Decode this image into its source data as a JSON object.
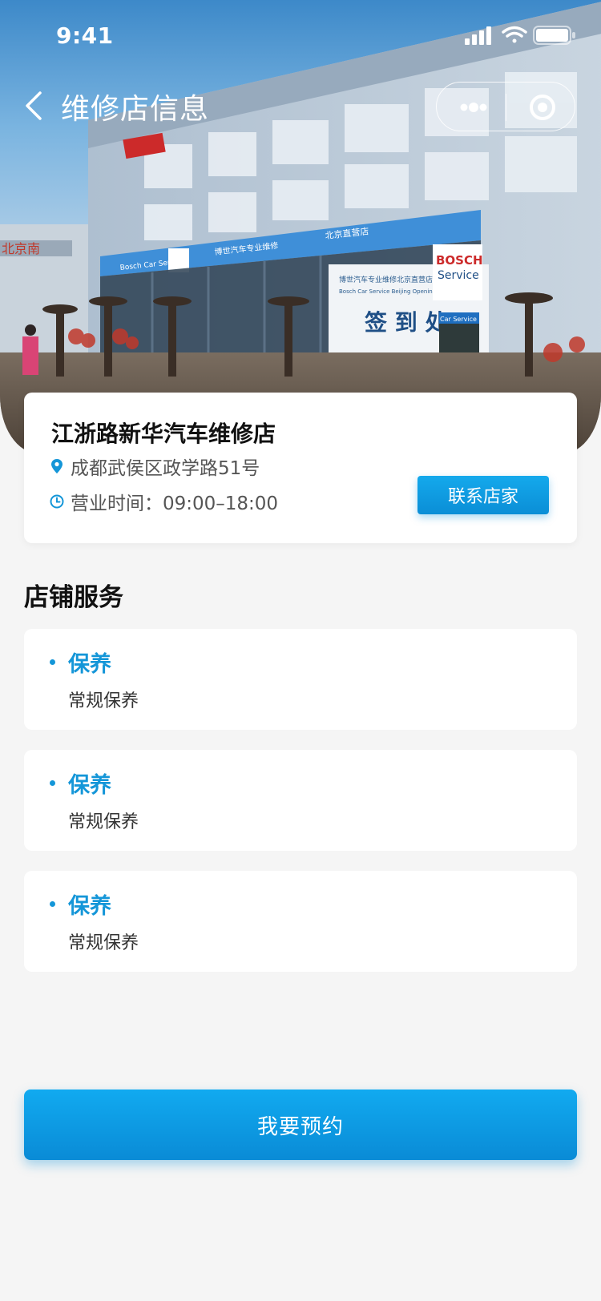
{
  "status_bar": {
    "time": "9:41"
  },
  "nav": {
    "title": "维修店信息"
  },
  "hero": {
    "signage": {
      "bosch": "BOSCH",
      "service": "Service",
      "car_service": "Car Service",
      "board_title": "签 到 处",
      "board_line1": "博世汽车专业维修北京直营店",
      "board_line2": "Bosch Car Service Beijing Opening",
      "fascia_left": "博世汽车专业维修",
      "fascia_right": "北京直营店",
      "fascia_far_left": "Bosch Car Service",
      "left_building": "北京南"
    }
  },
  "shop": {
    "name": "江浙路新华汽车维修店",
    "address": "成都武侯区政学路51号",
    "hours": "营业时间：09:00–18:00",
    "contact_label": "联系店家"
  },
  "services_section": {
    "title": "店铺服务",
    "items": [
      {
        "name": "保养",
        "desc": "常规保养"
      },
      {
        "name": "保养",
        "desc": "常规保养"
      },
      {
        "name": "保养",
        "desc": "常规保养"
      }
    ]
  },
  "booking": {
    "label": "我要预约"
  },
  "colors": {
    "accent": "#1496d8",
    "background": "#f5f5f5"
  }
}
